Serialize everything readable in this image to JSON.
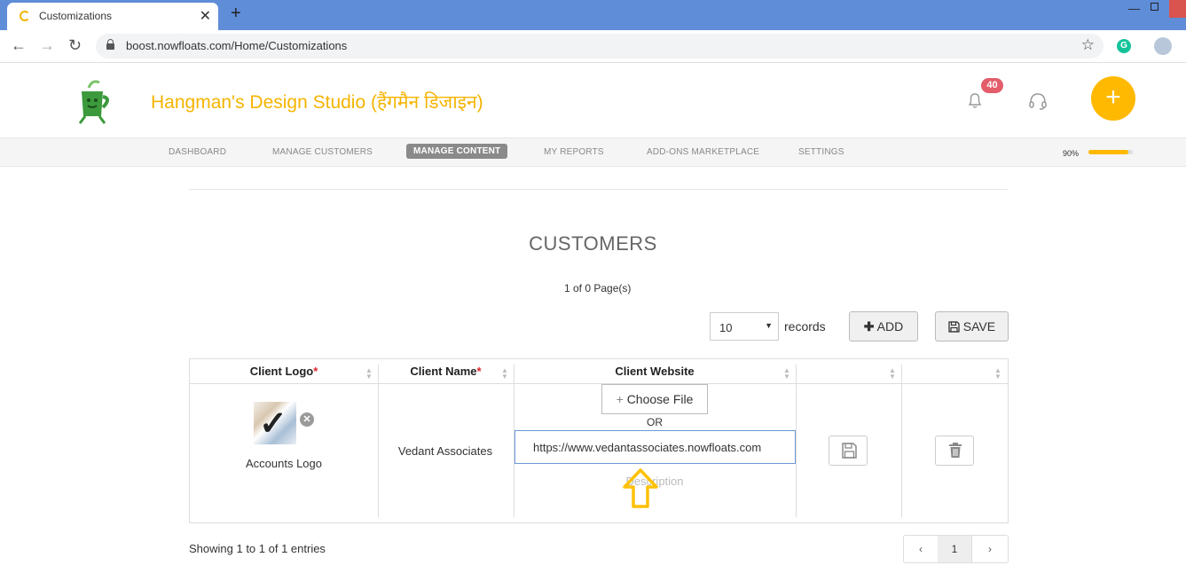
{
  "browser": {
    "tab_title": "Customizations",
    "url": "boost.nowfloats.com/Home/Customizations"
  },
  "header": {
    "business_name": "Hangman's Design Studio (हैंगमैन डिजाइन)",
    "notification_count": "40"
  },
  "nav": {
    "items": [
      "DASHBOARD",
      "MANAGE CUSTOMERS",
      "MANAGE CONTENT",
      "MY REPORTS",
      "ADD-ONS MARKETPLACE",
      "SETTINGS"
    ],
    "active": "MANAGE CONTENT",
    "progress_label": "90%",
    "progress_value": 0.9
  },
  "section": {
    "title": "CUSTOMERS",
    "page_count": "1 of 0 Page(s)"
  },
  "controls": {
    "records_value": "10",
    "records_label": "records",
    "add_label": "ADD",
    "save_label": "SAVE"
  },
  "table": {
    "columns": [
      "Client Logo",
      "Client Name",
      "Client Website",
      "",
      ""
    ],
    "required_marker": "*",
    "row": {
      "logo_label": "Accounts Logo",
      "client_name": "Vedant Associates",
      "choose_file_label": "Choose File",
      "or_label": "OR",
      "website_value": "https://www.vedantassociates.nowfloats.com",
      "description_placeholder": "Description"
    }
  },
  "footer": {
    "showing_text": "Showing 1 to 1 of 1 entries",
    "prev": "‹",
    "current_page": "1",
    "next": "›"
  },
  "colors": {
    "brand_yellow": "#ffb900",
    "badge_red": "#e35d6a",
    "required_red": "#d9262e",
    "input_focus_blue": "#6b9bd6"
  }
}
